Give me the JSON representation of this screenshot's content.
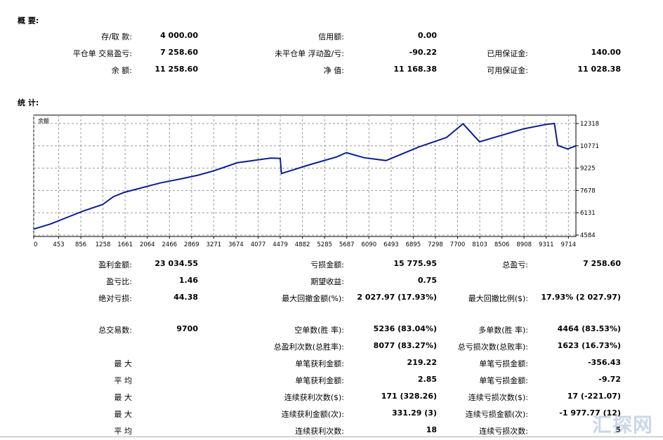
{
  "summary": {
    "title": "概 要:",
    "rows": [
      [
        {
          "label": "存/取 款:",
          "value": "4 000.00"
        },
        {
          "label": "信用额:",
          "value": "0.00"
        },
        {
          "label": "",
          "value": ""
        }
      ],
      [
        {
          "label": "平仓单 交易盈亏:",
          "value": "7 258.60"
        },
        {
          "label": "未平仓单 浮动盈/亏:",
          "value": "-90.22"
        },
        {
          "label": "已用保证金:",
          "value": "140.00"
        }
      ],
      [
        {
          "label": "余 额:",
          "value": "11 258.60"
        },
        {
          "label": "净 值:",
          "value": "11 168.38"
        },
        {
          "label": "可用保证金:",
          "value": "11 028.38"
        }
      ]
    ]
  },
  "stats_title": "统 计:",
  "chart_data": {
    "type": "line",
    "title": "余额",
    "x_ticks": [
      "0",
      "453",
      "856",
      "1258",
      "1661",
      "2064",
      "2466",
      "2869",
      "3271",
      "3674",
      "4077",
      "4479",
      "4882",
      "5285",
      "5687",
      "6090",
      "6493",
      "6895",
      "7298",
      "7700",
      "8103",
      "8506",
      "8908",
      "9311",
      "9714"
    ],
    "y_ticks": [
      "12318",
      "10771",
      "9225",
      "7678",
      "6131",
      "4584"
    ],
    "xlim": [
      0,
      9850
    ],
    "ylim": [
      4584,
      12318
    ],
    "series": [
      {
        "color": "#0a1f8f",
        "x": [
          0,
          300,
          600,
          900,
          1250,
          1450,
          1650,
          1900,
          2300,
          2700,
          3000,
          3280,
          3700,
          4300,
          4479,
          4500,
          5000,
          5500,
          5680,
          6000,
          6400,
          7000,
          7500,
          7800,
          8100,
          8500,
          8900,
          9300,
          9460,
          9520,
          9700,
          9850
        ],
        "y": [
          5000,
          5350,
          5800,
          6250,
          6700,
          7250,
          7550,
          7800,
          8200,
          8500,
          8750,
          9050,
          9600,
          9920,
          9900,
          8850,
          9450,
          10000,
          10300,
          9950,
          9750,
          10700,
          11350,
          12300,
          11050,
          11500,
          11950,
          12250,
          12318,
          10800,
          10550,
          10770
        ]
      }
    ]
  },
  "stats": {
    "rows": [
      [
        {
          "label": "盈利金额:",
          "value": "23 034.55"
        },
        {
          "label": "亏损金额:",
          "value": "15 775.95"
        },
        {
          "label": "总盈亏:",
          "value": "7 258.60"
        }
      ],
      [
        {
          "label": "盈亏比:",
          "value": "1.46"
        },
        {
          "label": "期望收益:",
          "value": "0.75"
        },
        {
          "label": "",
          "value": ""
        }
      ],
      [
        {
          "label": "绝对亏损:",
          "value": "44.38"
        },
        {
          "label": "最大回撤金额(%):",
          "value": "2 027.97 (17.93%)"
        },
        {
          "label": "最大回撤比例($):",
          "value": "17.93% (2 027.97)"
        }
      ],
      [
        {
          "label": "总交易数:",
          "value": "9700"
        },
        {
          "label": "空单数(胜 率):",
          "value": "5236 (83.04%)"
        },
        {
          "label": "多单数(胜 率):",
          "value": "4464 (83.53%)"
        }
      ],
      [
        {
          "label": "",
          "value": ""
        },
        {
          "label": "总盈利次数(总胜率):",
          "value": "8077 (83.27%)"
        },
        {
          "label": "总亏损次数(总败率):",
          "value": "1623 (16.73%)"
        }
      ],
      [
        {
          "label": "最 大",
          "value": ""
        },
        {
          "label": "单笔获利金额:",
          "value": "219.22"
        },
        {
          "label": "单笔亏损金额:",
          "value": "-356.43"
        }
      ],
      [
        {
          "label": "平 均",
          "value": ""
        },
        {
          "label": "单笔获利金额:",
          "value": "2.85"
        },
        {
          "label": "单笔亏损金额:",
          "value": "-9.72"
        }
      ],
      [
        {
          "label": "最 大",
          "value": ""
        },
        {
          "label": "连续获利次数($):",
          "value": "171 (328.26)"
        },
        {
          "label": "连续亏损次数($):",
          "value": "17 (-221.07)"
        }
      ],
      [
        {
          "label": "最 大",
          "value": ""
        },
        {
          "label": "连续获利金额(次):",
          "value": "331.29 (3)"
        },
        {
          "label": "连续亏损金额(次):",
          "value": "-1 977.77 (12)"
        }
      ],
      [
        {
          "label": "平 均",
          "value": ""
        },
        {
          "label": "连续获利次数:",
          "value": "18"
        },
        {
          "label": "连续亏损次数:",
          "value": "5"
        }
      ]
    ]
  },
  "watermark": "汇探网"
}
